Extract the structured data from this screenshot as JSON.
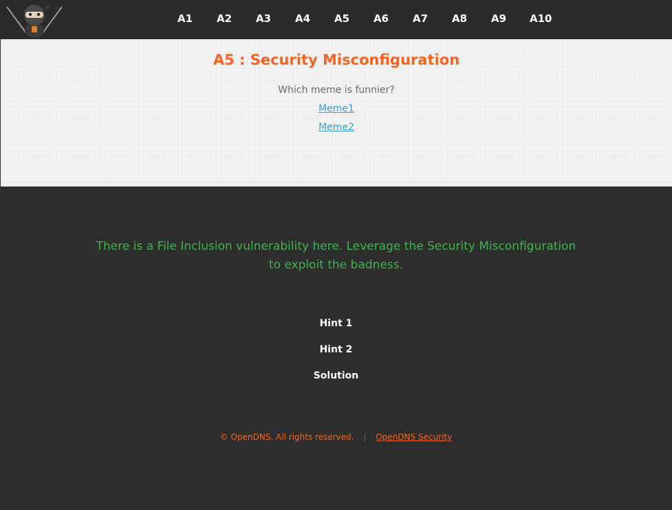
{
  "nav": {
    "items": [
      {
        "label": "A1"
      },
      {
        "label": "A2"
      },
      {
        "label": "A3"
      },
      {
        "label": "A4"
      },
      {
        "label": "A5"
      },
      {
        "label": "A6"
      },
      {
        "label": "A7"
      },
      {
        "label": "A8"
      },
      {
        "label": "A9"
      },
      {
        "label": "A10"
      }
    ],
    "logo_icon": "ninja-mascot-icon"
  },
  "main": {
    "title": "A5 : Security Misconfiguration",
    "question": "Which meme is funnier?",
    "links": [
      {
        "label": "Meme1"
      },
      {
        "label": "Meme2"
      }
    ]
  },
  "challenge": {
    "description": "There is a File Inclusion vulnerability here. Leverage the Security Misconfiguration to exploit the badness.",
    "hints": [
      {
        "label": "Hint 1"
      },
      {
        "label": "Hint 2"
      },
      {
        "label": "Solution"
      }
    ]
  },
  "footer": {
    "copyright": "© OpenDNS. All rights reserved.",
    "separator": "|",
    "link": "OpenDNS Security"
  },
  "colors": {
    "accent": "#f26522",
    "link": "#3a9fd1",
    "description": "#3fb34f",
    "dark_bg": "#2e2e2e",
    "light_bg": "#f1f1f1"
  }
}
